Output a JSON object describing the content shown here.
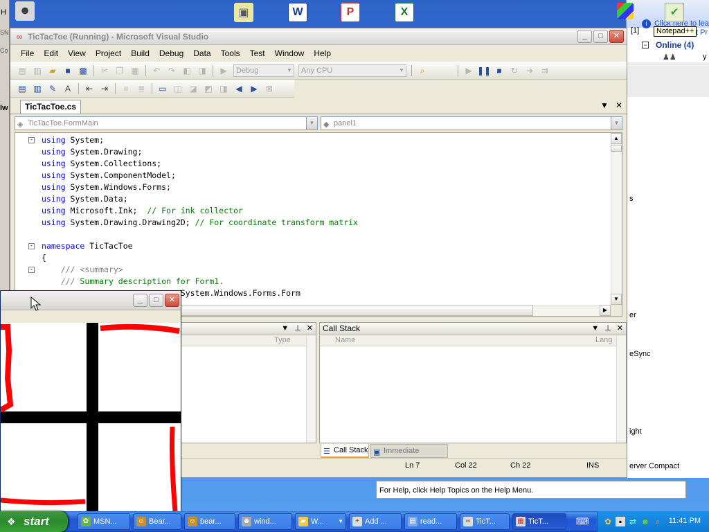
{
  "vs": {
    "title": "TicTacToe (Running) - Microsoft Visual Studio",
    "menu": [
      "File",
      "Edit",
      "View",
      "Project",
      "Build",
      "Debug",
      "Data",
      "Tools",
      "Test",
      "Window",
      "Help"
    ],
    "toolbar": {
      "config": "Debug",
      "platform": "Any CPU"
    },
    "doc_tab": "TicTacToe.cs",
    "nav_left": "TicTacToe.FormMain",
    "nav_right": "panel1",
    "code": [
      {
        "fold": "-",
        "parts": [
          {
            "k": "kw",
            "t": "using"
          },
          {
            "k": "",
            "t": " System;"
          }
        ]
      },
      {
        "fold": "",
        "parts": [
          {
            "k": "kw",
            "t": "using"
          },
          {
            "k": "",
            "t": " System.Drawing;"
          }
        ]
      },
      {
        "fold": "",
        "parts": [
          {
            "k": "kw",
            "t": "using"
          },
          {
            "k": "",
            "t": " System.Collections;"
          }
        ]
      },
      {
        "fold": "",
        "parts": [
          {
            "k": "kw",
            "t": "using"
          },
          {
            "k": "",
            "t": " System.ComponentModel;"
          }
        ]
      },
      {
        "fold": "",
        "parts": [
          {
            "k": "kw",
            "t": "using"
          },
          {
            "k": "",
            "t": " System.Windows.Forms;"
          }
        ]
      },
      {
        "fold": "",
        "parts": [
          {
            "k": "kw",
            "t": "using"
          },
          {
            "k": "",
            "t": " System.Data;"
          }
        ]
      },
      {
        "fold": "",
        "parts": [
          {
            "k": "kw",
            "t": "using"
          },
          {
            "k": "",
            "t": " Microsoft.Ink;  "
          },
          {
            "k": "cm",
            "t": "// For ink collector"
          }
        ]
      },
      {
        "fold": "",
        "parts": [
          {
            "k": "kw",
            "t": "using"
          },
          {
            "k": "",
            "t": " System.Drawing.Drawing2D; "
          },
          {
            "k": "cm",
            "t": "// For coordinate transform matrix"
          }
        ]
      },
      {
        "fold": "",
        "parts": [
          {
            "k": "",
            "t": ""
          }
        ]
      },
      {
        "fold": "-",
        "parts": [
          {
            "k": "kw",
            "t": "namespace"
          },
          {
            "k": "",
            "t": " TicTacToe"
          }
        ]
      },
      {
        "fold": "",
        "parts": [
          {
            "k": "",
            "t": "{"
          }
        ]
      },
      {
        "fold": "-",
        "parts": [
          {
            "k": "",
            "t": "    "
          },
          {
            "k": "xmlc",
            "t": "/// <summary>"
          }
        ]
      },
      {
        "fold": "",
        "parts": [
          {
            "k": "",
            "t": "    "
          },
          {
            "k": "xmlc",
            "t": "/// "
          },
          {
            "k": "cm",
            "t": "Summary description for Form1."
          }
        ]
      },
      {
        "fold": "",
        "parts": [
          {
            "k": "",
            "t": "                             System.Windows.Forms.Form"
          }
        ]
      }
    ],
    "locals": {
      "col_type": "Type"
    },
    "callstack": {
      "title": "Call Stack",
      "col_name": "Name",
      "col_lang": "Lang"
    },
    "bottom_tabs": [
      "Call Stack",
      "Immediate Window"
    ],
    "status": {
      "ln": "Ln 7",
      "col": "Col 22",
      "ch": "Ch 22",
      "ins": "INS"
    }
  },
  "help_text": "For Help, click Help Topics on the Help Menu.",
  "messenger": {
    "online": "Online (4)",
    "tip_line1": "Click here to lear",
    "tip_line2": "t Pr",
    "labels": [
      "s",
      "er",
      "eSync",
      "ight",
      "erver Compact"
    ],
    "notepad_tooltip": "Notepad++",
    "badge": "[1]"
  },
  "left_bg": {
    "labels": [
      "H",
      "SN",
      "Co",
      "lw"
    ]
  },
  "taskbar": {
    "start": "start",
    "items": [
      "MSN...",
      "Bear...",
      "bear...",
      "wind...",
      "W...",
      "Add ...",
      "read...",
      "TicT...",
      "TicT..."
    ],
    "clock": "11:41 PM"
  },
  "colors": {
    "accent": "#0000ff",
    "comment": "#008000",
    "ink": "#ff0000"
  }
}
